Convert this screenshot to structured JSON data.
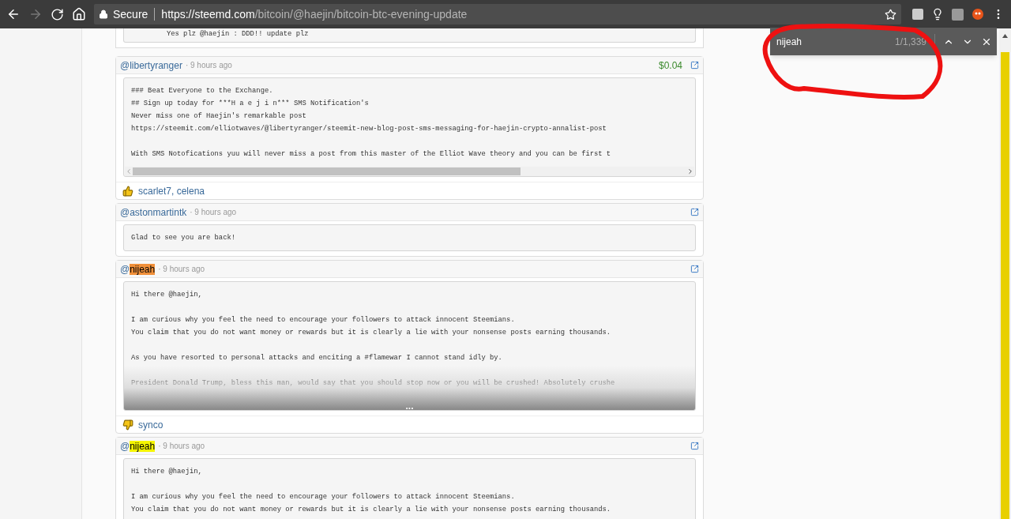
{
  "browser": {
    "security": "Secure",
    "url_host": "https://steemd.com",
    "url_path": "/bitcoin/@haejin/bitcoin-btc-evening-update",
    "forward_disabled": true
  },
  "find_bar": {
    "query": "nijeah",
    "count": "1/1,339"
  },
  "top_comment": {
    "body": "Yes plz @haejin : DDD!! update plz"
  },
  "comments": [
    {
      "author_prefix": "@",
      "author": "libertyranger",
      "search_match": false,
      "current_match": false,
      "time": "· 9 hours ago",
      "payout": "$0.04",
      "collapsed": false,
      "scrollbar": true,
      "body": [
        [
          "### Beat Everyone to the Exchange.",
          "## Sign up today for ***H a e j i n*** SMS Notification's",
          "Never miss one of Haejin's remarkable post",
          "https://steemit.com/elliotwaves/@libertyranger/steemit-new-blog-post-sms-messaging-for-haejin-crypto-annalist-post"
        ],
        [
          "With SMS Notofications yuu will never miss a post from this master of the Elliot Wave theory and you can be first t"
        ]
      ],
      "votes": {
        "kind": "up",
        "voters": "scarlet7, celena"
      }
    },
    {
      "author_prefix": "@",
      "author": "astonmartintk",
      "search_match": false,
      "current_match": false,
      "time": "· 9 hours ago",
      "collapsed": false,
      "scrollbar": false,
      "body": [
        [
          "Glad to see you are back!"
        ]
      ]
    },
    {
      "author_prefix": "@",
      "author": "nijeah",
      "search_match": true,
      "current_match": true,
      "time": "· 9 hours ago",
      "collapsed": true,
      "scrollbar": false,
      "expand": "...",
      "body": [
        [
          "Hi there @haejin,"
        ],
        [
          "I am curious why you feel the need to encourage your followers to attack innocent Steemians.",
          "You claim that you do not want money or rewards but it is clearly a lie with your nonsense posts earning thousands."
        ],
        [
          "As you have resorted to personal attacks and enciting a #flamewar I cannot stand idly by."
        ],
        [
          "President Donald Trump, bless this man, would say that you should stop now or you will be crushed! Absolutely crushe"
        ]
      ],
      "votes": {
        "kind": "down",
        "voters": "synco"
      }
    },
    {
      "author_prefix": "@",
      "author": "nijeah",
      "search_match": true,
      "current_match": false,
      "time": "· 9 hours ago",
      "collapsed": false,
      "scrollbar": false,
      "body": [
        [
          "Hi there @haejin,"
        ],
        [
          "I am curious why you feel the need to encourage your followers to attack innocent Steemians.",
          "You claim that you do not want money or rewards but it is clearly a lie with your nonsense posts earning thousands."
        ]
      ]
    }
  ]
}
